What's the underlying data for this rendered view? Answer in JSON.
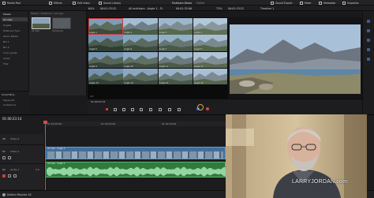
{
  "topbar": {
    "media_pool": "Media Pool",
    "effects": "Effects",
    "edit_index": "Edit Index",
    "sound_library": "Sound Library",
    "project_title": "Multicam Demo",
    "edited": "Edited",
    "sound_export": "Sound Export",
    "mixer": "Mixer",
    "metadata": "Metadata",
    "inspector": "Inspector"
  },
  "secondbar": {
    "zoom": "64%",
    "timecode_left": "00:01:33:22",
    "clip_name": "All multicam - Angle 1 - FL",
    "timecode_mid": "00:01:32:06",
    "timeline_name": "Multicam Demo - Angle 1",
    "zoom_right": "73%",
    "timecode_right": "00:01:33:22",
    "timeline_label": "Timeline 1"
  },
  "media_pool": {
    "header": "Master",
    "items": [
      "All clips",
      "Angles",
      "Multicam Sync",
      "Demo Media",
      "Bin 1",
      "Bin 2",
      "Color grade",
      "Audio",
      "Title"
    ],
    "smart_bins_header": "Smart Bins",
    "smart_bins": [
      "Keywords",
      "Collections"
    ]
  },
  "bin": {
    "path": "Master / Multicam / All clips",
    "clips": [
      {
        "name": "All clips"
      },
      {
        "name": "Compound"
      }
    ]
  },
  "multicam": {
    "angles": [
      "Angle 1",
      "Angle 2",
      "Angle 3",
      "Angle 4",
      "Angle 5",
      "Angle 6",
      "Angle 7",
      "Angle 8",
      "Angle 9",
      "Angle 10",
      "Angle 11",
      "Angle 12",
      "Angle 13",
      "Angle 14",
      "Angle 15",
      "Angle 16"
    ],
    "selected_index": 0,
    "page_label": "1/1"
  },
  "transport": {
    "timecode": "01:00:23:14",
    "tools": [
      "select",
      "trim",
      "blade",
      "link",
      "snap",
      "flag",
      "marker"
    ]
  },
  "timeline": {
    "timecode": "01:00:23:14",
    "ruler_marks": [
      "01:00:00:00",
      "01:00:16:00",
      "01:00:32:00"
    ],
    "tracks": [
      {
        "id": "V2",
        "name": "Video 2"
      },
      {
        "id": "V1",
        "name": "Video 1"
      },
      {
        "id": "A1",
        "name": "Audio 1",
        "level": "2.0"
      }
    ],
    "clip_labels": [
      "All clips - Angle 1",
      "All clips - Angle 1"
    ]
  },
  "bottombar": {
    "app_name": "DaVinci Resolve 18"
  },
  "webcam": {
    "watermark": "LARRYJORDAN.com"
  },
  "colors": {
    "accent_red": "#d53a3a",
    "playhead": "#e8a23c",
    "video_clip": "#3f6fa0",
    "audio_clip": "#3a8a48",
    "panel_bg": "#1f1f22"
  }
}
